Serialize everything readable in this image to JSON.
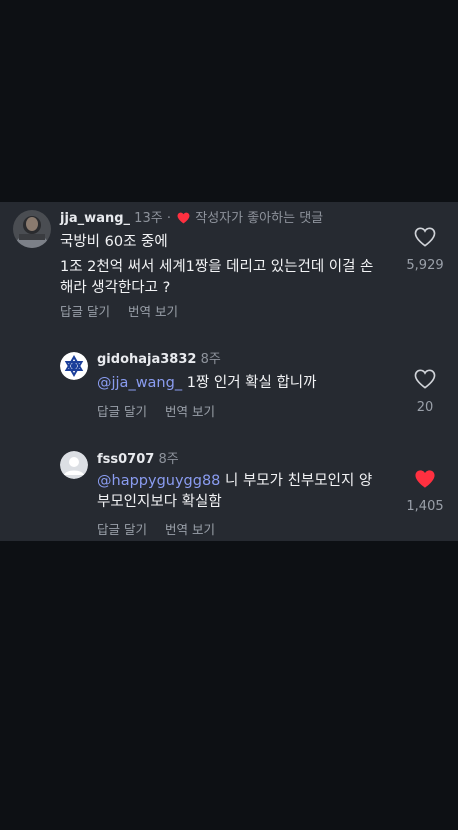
{
  "comments": [
    {
      "username": "jja_wang_",
      "time": "13주",
      "separator": "·",
      "creator_liked": "작성자가 좋아하는 댓글",
      "lines": [
        "국방비 60조 중에",
        "1조 2천억 써서 세계1짱을 데리고 있는건데 이걸 손",
        "해라 생각한다고 ?"
      ],
      "like_count": "5,929",
      "liked": false,
      "actions": [
        "답글 달기",
        "번역 보기"
      ],
      "avatar_icon": "user-photo-avatar"
    },
    {
      "username": "gidohaja3832",
      "time": "8주",
      "mention": "@jja_wang_",
      "text": " 1짱 인거 확실 합니까",
      "like_count": "20",
      "liked": false,
      "actions": [
        "답글 달기",
        "번역 보기"
      ],
      "avatar_icon": "star-of-david-avatar"
    },
    {
      "username": "fss0707",
      "time": "8주",
      "mention": "@happyguygg88",
      "text_line1": " 니 부모가 친부모인지 양",
      "text_line2": "부모인지보다 확실함",
      "like_count": "1,405",
      "liked": true,
      "actions": [
        "답글 달기",
        "번역 보기"
      ],
      "avatar_icon": "default-person-avatar"
    }
  ],
  "colors": {
    "background": "#0d1014",
    "panel": "#262a31",
    "mention": "#8a9cf0",
    "heart_red": "#ff3040"
  }
}
